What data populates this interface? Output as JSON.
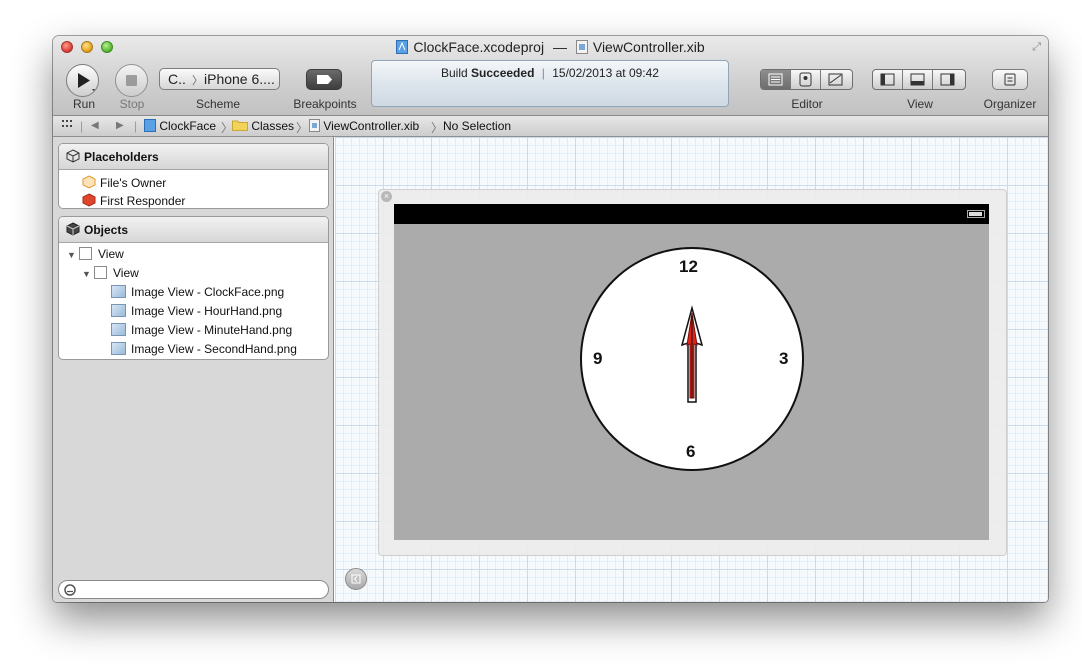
{
  "window": {
    "title_project": "ClockFace.xcodeproj",
    "title_separator": "—",
    "title_file": "ViewController.xib"
  },
  "toolbar": {
    "run_label": "Run",
    "stop_label": "Stop",
    "scheme_target": "C..",
    "scheme_device": "iPhone 6....",
    "scheme_label": "Scheme",
    "breakpoints_label": "Breakpoints",
    "editor_label": "Editor",
    "view_label": "View",
    "organizer_label": "Organizer"
  },
  "activity": {
    "prefix": "Build",
    "status": "Succeeded",
    "separator": "|",
    "timestamp": "15/02/2013 at 09:42"
  },
  "jumpbar": {
    "crumbs": [
      "ClockFace",
      "Classes",
      "ViewController.xib",
      "No Selection"
    ]
  },
  "navigator": {
    "placeholders_title": "Placeholders",
    "placeholders": [
      "File's Owner",
      "First Responder"
    ],
    "objects_title": "Objects",
    "objects": {
      "root": "View",
      "child": "View",
      "images": [
        "Image View - ClockFace.png",
        "Image View - HourHand.png",
        "Image View - MinuteHand.png",
        "Image View - SecondHand.png"
      ]
    }
  },
  "clock": {
    "n12": "12",
    "n3": "3",
    "n6": "6",
    "n9": "9",
    "hand_color": "#e0231b"
  }
}
